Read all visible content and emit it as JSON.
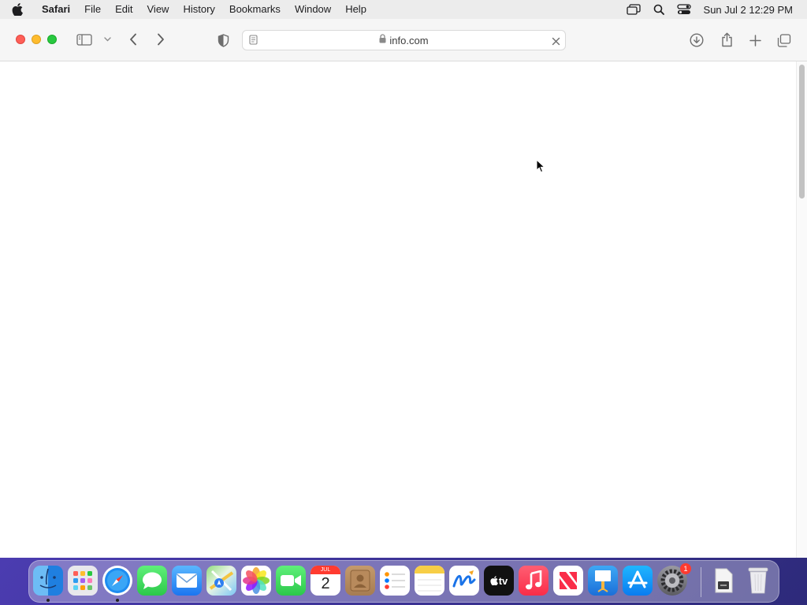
{
  "menubar": {
    "app_name": "Safari",
    "items": [
      "File",
      "Edit",
      "View",
      "History",
      "Bookmarks",
      "Window",
      "Help"
    ],
    "clock": "Sun Jul 2  12:29 PM",
    "status_icons": [
      "screen-mirroring-icon",
      "spotlight-search-icon",
      "control-center-icon"
    ]
  },
  "browser": {
    "url": "info.com",
    "secure": true
  },
  "dock": {
    "calendar": {
      "month": "JUL",
      "day": "2"
    },
    "tv_label": "tv",
    "settings_badge": "1",
    "apps": [
      "Finder",
      "Launchpad",
      "Safari",
      "Messages",
      "Mail",
      "Maps",
      "Photos",
      "FaceTime",
      "Calendar",
      "Contacts",
      "Reminders",
      "Notes",
      "Freeform",
      "TV",
      "Music",
      "News",
      "Keynote",
      "App Store",
      "System Settings",
      "Downloads",
      "Trash"
    ],
    "running": [
      "Finder",
      "Safari"
    ]
  },
  "colors": {
    "close": "#fe5f57",
    "minimize": "#febc2e",
    "maximize": "#28c840"
  }
}
